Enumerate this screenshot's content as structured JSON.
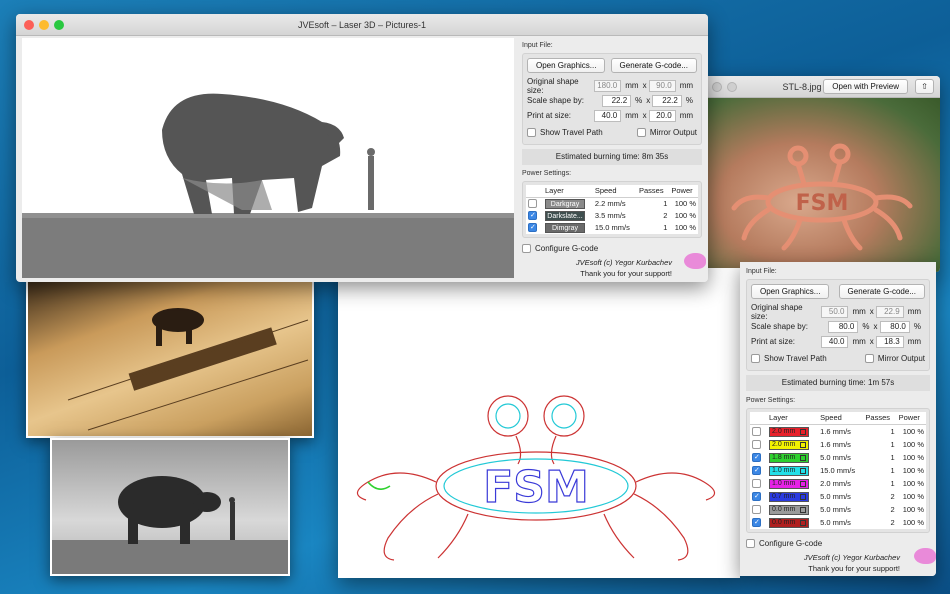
{
  "main_window": {
    "title": "JVEsoft – Laser 3D – Pictures-1",
    "input_file_label": "Input File:",
    "open_graphics": "Open Graphics...",
    "generate_gcode": "Generate G-code...",
    "original_size_label": "Original shape size:",
    "original_w": "180.0",
    "original_h": "90.0",
    "scale_label": "Scale shape by:",
    "scale_x": "22.2",
    "scale_y": "22.2",
    "print_label": "Print at size:",
    "print_w": "40.0",
    "print_h": "20.0",
    "unit_mm": "mm",
    "unit_x": "x",
    "unit_pct": "%",
    "show_travel": "Show Travel Path",
    "mirror": "Mirror Output",
    "est_label": "Estimated burning time:",
    "est_value": "8m 35s",
    "power_label": "Power Settings:",
    "headers": [
      "Layer",
      "Speed",
      "Passes",
      "Power"
    ],
    "layers": [
      {
        "name": "Darkgray",
        "speed": "2.2 mm/s",
        "passes": "1",
        "power": "100 %",
        "checked": false,
        "color": "#8a8a8a"
      },
      {
        "name": "Darkslate...",
        "speed": "3.5 mm/s",
        "passes": "2",
        "power": "100 %",
        "checked": true,
        "color": "#3f4f4f"
      },
      {
        "name": "Dimgray",
        "speed": "15.0 mm/s",
        "passes": "1",
        "power": "100 %",
        "checked": true,
        "color": "#6a6a6a"
      }
    ],
    "configure": "Configure G-code",
    "credit": "JVEsoft (c) Yegor Kurbachev",
    "thanks": "Thank you for your support!"
  },
  "preview_window": {
    "title": "STL-8.jpg",
    "open_with": "Open with Preview",
    "fsm_text": "FSM"
  },
  "second_window": {
    "input_file_label": "Input File:",
    "open_graphics": "Open Graphics...",
    "generate_gcode": "Generate G-code...",
    "original_size_label": "Original shape size:",
    "original_w": "50.0",
    "original_h": "22.9",
    "scale_label": "Scale shape by:",
    "scale_x": "80.0",
    "scale_y": "80.0",
    "print_label": "Print at size:",
    "print_w": "40.0",
    "print_h": "18.3",
    "unit_mm": "mm",
    "unit_x": "x",
    "unit_pct": "%",
    "show_travel": "Show Travel Path",
    "mirror": "Mirror Output",
    "est_label": "Estimated burning time:",
    "est_value": "1m 57s",
    "power_label": "Power Settings:",
    "headers": [
      "Layer",
      "Speed",
      "Passes",
      "Power"
    ],
    "layers": [
      {
        "name": "2.0 mm",
        "speed": "1.6 mm/s",
        "passes": "1",
        "power": "100 %",
        "checked": false,
        "color": "#e8202a"
      },
      {
        "name": "2.0 mm",
        "speed": "1.6 mm/s",
        "passes": "1",
        "power": "100 %",
        "checked": false,
        "color": "#f2f200"
      },
      {
        "name": "1.8 mm",
        "speed": "5.0 mm/s",
        "passes": "1",
        "power": "100 %",
        "checked": true,
        "color": "#2fd12f"
      },
      {
        "name": "1.0 mm",
        "speed": "15.0 mm/s",
        "passes": "1",
        "power": "100 %",
        "checked": true,
        "color": "#22e0e8"
      },
      {
        "name": "1.0 mm",
        "speed": "2.0 mm/s",
        "passes": "1",
        "power": "100 %",
        "checked": false,
        "color": "#e620e6"
      },
      {
        "name": "0.7 mm",
        "speed": "5.0 mm/s",
        "passes": "2",
        "power": "100 %",
        "checked": true,
        "color": "#2a3ae0"
      },
      {
        "name": "0.0 mm",
        "speed": "5.0 mm/s",
        "passes": "2",
        "power": "100 %",
        "checked": false,
        "color": "#9a9a9a"
      },
      {
        "name": "0.0 mm",
        "speed": "5.0 mm/s",
        "passes": "2",
        "power": "100 %",
        "checked": true,
        "color": "#b02020"
      }
    ],
    "configure": "Configure G-code",
    "credit": "JVEsoft (c) Yegor Kurbachev",
    "thanks": "Thank you for your support!"
  }
}
